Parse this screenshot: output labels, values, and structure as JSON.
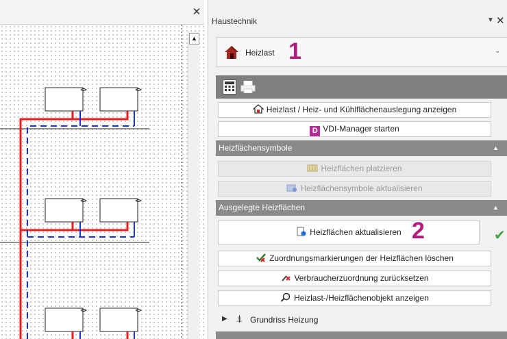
{
  "panel": {
    "title": "Haustechnik",
    "module_select": {
      "selected": "Heizlast"
    },
    "callouts": {
      "one": "1",
      "two": "2"
    },
    "buttons": {
      "heizlast_anzeigen": "Heizlast / Heiz- und Kühlflächenauslegung anzeigen",
      "vdi_manager": "VDI-Manager starten",
      "vdi_icon_letter": "D"
    },
    "sections": {
      "heizflaechensymbole": {
        "title": "Heizflächensymbole",
        "buttons": {
          "platzieren": "Heizflächen platzieren",
          "symbole_aktualisieren": "Heizflächensymbole aktualisieren"
        }
      },
      "ausgelegte": {
        "title": "Ausgelegte Heizflächen",
        "buttons": {
          "aktualisieren": "Heizflächen aktualisieren",
          "zuordnung_loeschen": "Zuordnungsmarkierungen der Heizflächen löschen",
          "verbraucher_zuruecksetzen": "Verbraucherzuordnung zurücksetzen",
          "objekt_anzeigen": "Heizlast-/Heizflächenobjekt anzeigen"
        }
      }
    },
    "tree": {
      "grundriss": "Grundriss Heizung"
    }
  },
  "icons": {
    "close": "close-icon",
    "pin": "pin-icon",
    "module": "house-heat-icon",
    "check": "checkmark-icon",
    "calculator": "calculator-icon",
    "print": "print-icon"
  },
  "colors": {
    "accent_callout": "#b01b7d",
    "section_header": "#8a8a8a",
    "toolbar": "#7f7f7f",
    "pipe_supply": "#e02020",
    "pipe_return": "#1a35d6"
  }
}
